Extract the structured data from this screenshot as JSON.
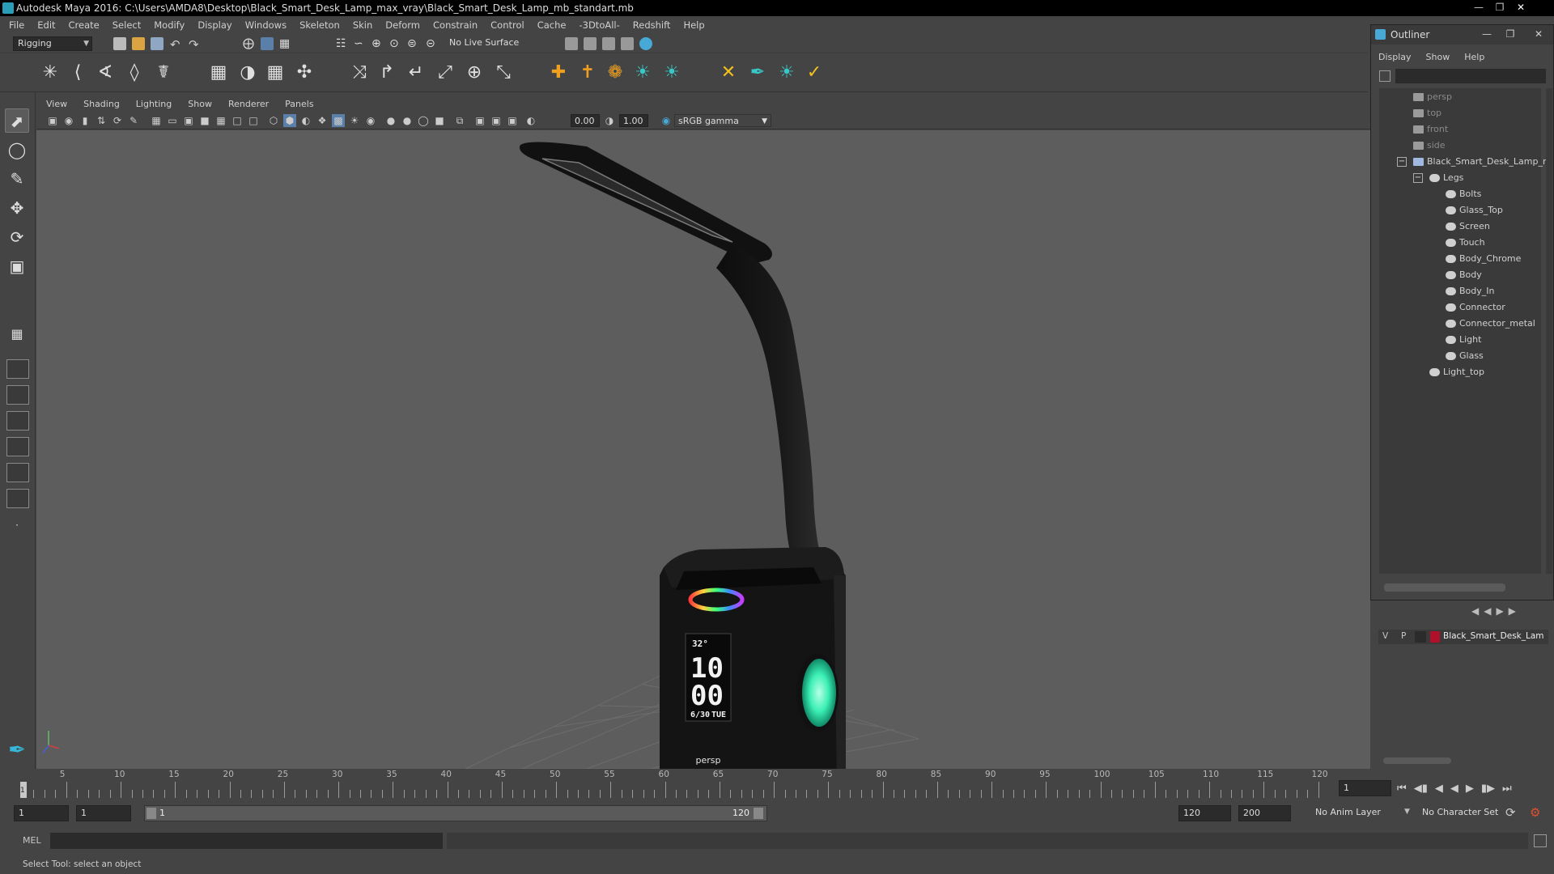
{
  "window": {
    "title": "Autodesk Maya 2016: C:\\Users\\AMDA8\\Desktop\\Black_Smart_Desk_Lamp_max_vray\\Black_Smart_Desk_Lamp_mb_standart.mb"
  },
  "menubar": [
    "File",
    "Edit",
    "Create",
    "Select",
    "Modify",
    "Display",
    "Windows",
    "Skeleton",
    "Skin",
    "Deform",
    "Constrain",
    "Control",
    "Cache",
    "-3DtoAll-",
    "Redshift",
    "Help"
  ],
  "statusline": {
    "mode": "Rigging",
    "live_surface": "No Live Surface"
  },
  "panel": {
    "menu": [
      "View",
      "Shading",
      "Lighting",
      "Show",
      "Renderer",
      "Panels"
    ],
    "exposure": "0.00",
    "gamma": "1.00",
    "colorspace": "sRGB gamma",
    "camera": "persp"
  },
  "lamp": {
    "display_temp": "32°",
    "display_hours": "10",
    "display_minutes": "00",
    "display_date": "6/30",
    "display_day": "TUE",
    "glow_color": "#3cf0b4"
  },
  "outliner": {
    "title": "Outliner",
    "menu": [
      "Display",
      "Show",
      "Help"
    ],
    "items": [
      {
        "label": "persp",
        "type": "camera",
        "depth": 1,
        "dim": true
      },
      {
        "label": "top",
        "type": "camera",
        "depth": 1,
        "dim": true
      },
      {
        "label": "front",
        "type": "camera",
        "depth": 1,
        "dim": true
      },
      {
        "label": "side",
        "type": "camera",
        "depth": 1,
        "dim": true
      },
      {
        "label": "Black_Smart_Desk_Lamp_n",
        "type": "group",
        "depth": 1,
        "expand": "minus"
      },
      {
        "label": "Legs",
        "type": "mesh",
        "depth": 2,
        "expand": "minus"
      },
      {
        "label": "Bolts",
        "type": "mesh",
        "depth": 3
      },
      {
        "label": "Glass_Top",
        "type": "mesh",
        "depth": 3
      },
      {
        "label": "Screen",
        "type": "mesh",
        "depth": 3
      },
      {
        "label": "Touch",
        "type": "mesh",
        "depth": 3
      },
      {
        "label": "Body_Chrome",
        "type": "mesh",
        "depth": 3
      },
      {
        "label": "Body",
        "type": "mesh",
        "depth": 3
      },
      {
        "label": "Body_In",
        "type": "mesh",
        "depth": 3
      },
      {
        "label": "Connector",
        "type": "mesh",
        "depth": 3
      },
      {
        "label": "Connector_metal",
        "type": "mesh",
        "depth": 3
      },
      {
        "label": "Light",
        "type": "mesh",
        "depth": 3
      },
      {
        "label": "Glass",
        "type": "mesh",
        "depth": 3
      },
      {
        "label": "Light_top",
        "type": "mesh",
        "depth": 2
      }
    ]
  },
  "layers": {
    "v": "V",
    "p": "P",
    "name": "Black_Smart_Desk_Lam",
    "color": "#b0102a"
  },
  "timeline": {
    "ticks": [
      "5",
      "10",
      "15",
      "20",
      "25",
      "30",
      "35",
      "40",
      "45",
      "50",
      "55",
      "60",
      "65",
      "70",
      "75",
      "80",
      "85",
      "90",
      "95",
      "100",
      "105",
      "110",
      "115",
      "120"
    ],
    "current_frame": "1",
    "current_frame_field": "1"
  },
  "range": {
    "start": "1",
    "playback_start": "1",
    "slider_start": "1",
    "slider_end": "120",
    "playback_end": "120",
    "end": "200",
    "anim_layer": "No Anim Layer",
    "char_set": "No Character Set"
  },
  "cmdline": {
    "lang": "MEL"
  },
  "helpline": {
    "text": "Select Tool: select an object"
  }
}
